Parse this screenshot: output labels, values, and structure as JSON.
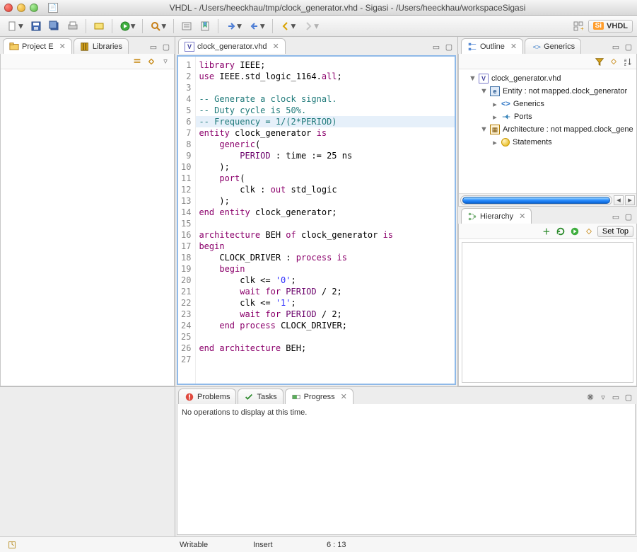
{
  "window": {
    "title": "VHDL - /Users/heeckhau/tmp/clock_generator.vhd - Sigasi - /Users/heeckhau/workspaceSigasi"
  },
  "perspective": {
    "prefix": "Si",
    "label": "VHDL"
  },
  "left_views": {
    "project_explorer": "Project E",
    "libraries": "Libraries"
  },
  "editor": {
    "filename": "clock_generator.vhd",
    "lines": [
      {
        "n": 1,
        "html": "<span class='kw'>library</span> IEEE;"
      },
      {
        "n": 2,
        "html": "<span class='kw'>use</span> IEEE.std_logic_1164.<span class='kw'>all</span>;"
      },
      {
        "n": 3,
        "html": ""
      },
      {
        "n": 4,
        "html": "<span class='cm'>-- Generate a clock signal.</span>"
      },
      {
        "n": 5,
        "html": "<span class='cm'>-- Duty cycle is 50%.</span>"
      },
      {
        "n": 6,
        "html": "<span class='cm'>-- Frequency = 1/(2*PERIOD)</span>",
        "hl": true
      },
      {
        "n": 7,
        "html": "<span class='kw'>entity</span> clock_generator <span class='kw'>is</span>"
      },
      {
        "n": 8,
        "html": "    <span class='kw'>generic</span>("
      },
      {
        "n": 9,
        "html": "        <span class='fn'>PERIOD</span> : time := 25 ns"
      },
      {
        "n": 10,
        "html": "    );"
      },
      {
        "n": 11,
        "html": "    <span class='kw'>port</span>("
      },
      {
        "n": 12,
        "html": "        clk : <span class='kw'>out</span> std_logic"
      },
      {
        "n": 13,
        "html": "    );"
      },
      {
        "n": 14,
        "html": "<span class='kw'>end entity</span> clock_generator;"
      },
      {
        "n": 15,
        "html": ""
      },
      {
        "n": 16,
        "html": "<span class='kw'>architecture</span> BEH <span class='kw'>of</span> clock_generator <span class='kw'>is</span>"
      },
      {
        "n": 17,
        "html": "<span class='kw'>begin</span>"
      },
      {
        "n": 18,
        "html": "    CLOCK_DRIVER : <span class='kw'>process is</span>"
      },
      {
        "n": 19,
        "html": "    <span class='kw'>begin</span>"
      },
      {
        "n": 20,
        "html": "        clk &lt;= <span class='str'>'0'</span>;"
      },
      {
        "n": 21,
        "html": "        <span class='kw'>wait for</span> <span class='fn'>PERIOD</span> / 2;"
      },
      {
        "n": 22,
        "html": "        clk &lt;= <span class='str'>'1'</span>;"
      },
      {
        "n": 23,
        "html": "        <span class='kw'>wait for</span> <span class='fn'>PERIOD</span> / 2;"
      },
      {
        "n": 24,
        "html": "    <span class='kw'>end process</span> CLOCK_DRIVER;"
      },
      {
        "n": 25,
        "html": ""
      },
      {
        "n": 26,
        "html": "<span class='kw'>end architecture</span> BEH;"
      },
      {
        "n": 27,
        "html": ""
      }
    ]
  },
  "outline": {
    "tab": "Outline",
    "tab2": "Generics",
    "root": "clock_generator.vhd",
    "entity": "Entity : not mapped.clock_generator",
    "generics": "Generics",
    "ports": "Ports",
    "architecture": "Architecture : not mapped.clock_gene",
    "statements": "Statements"
  },
  "hierarchy": {
    "tab": "Hierarchy",
    "set_top": "Set Top"
  },
  "bottom": {
    "problems": "Problems",
    "tasks": "Tasks",
    "progress": "Progress",
    "message": "No operations to display at this time."
  },
  "status": {
    "writable": "Writable",
    "insert": "Insert",
    "position": "6 : 13"
  }
}
